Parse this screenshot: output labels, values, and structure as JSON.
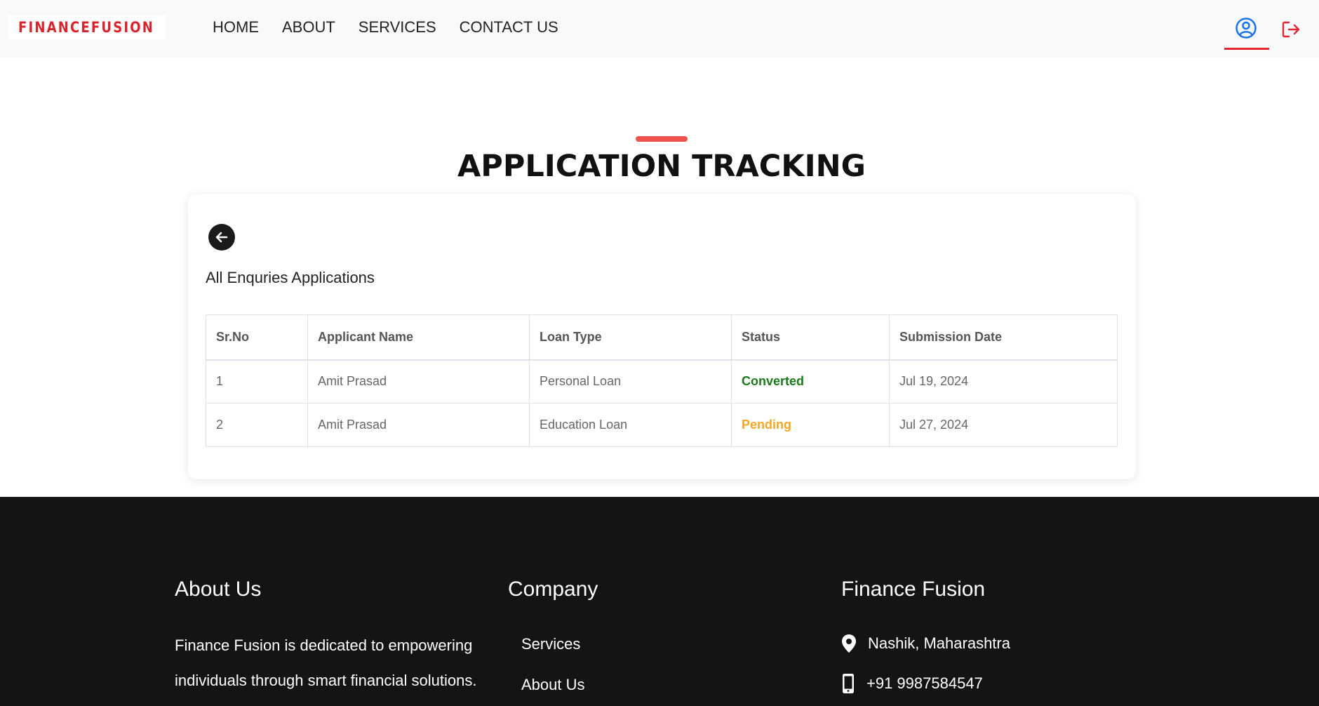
{
  "brand": {
    "name": "FINANCEFUSION",
    "accent": "#d9232d"
  },
  "nav": {
    "items": [
      {
        "label": "HOME"
      },
      {
        "label": "ABOUT"
      },
      {
        "label": "SERVICES"
      },
      {
        "label": "CONTACT US"
      }
    ],
    "user_icon": "user-circle-icon",
    "logout_icon": "logout-icon"
  },
  "page": {
    "title": "APPLICATION TRACKING"
  },
  "card": {
    "back_icon": "arrow-left-icon",
    "subtitle": "All Enquries Applications",
    "table": {
      "headers": [
        "Sr.No",
        "Applicant Name",
        "Loan Type",
        "Status",
        "Submission Date"
      ],
      "rows": [
        {
          "sr": "1",
          "name": "Amit Prasad",
          "loan_type": "Personal Loan",
          "status": "Converted",
          "date": "Jul 19, 2024"
        },
        {
          "sr": "2",
          "name": "Amit Prasad",
          "loan_type": "Education Loan",
          "status": "Pending",
          "date": "Jul 27, 2024"
        }
      ]
    },
    "status_colors": {
      "Converted": "#1b7a1b",
      "Pending": "#f5a623"
    }
  },
  "footer": {
    "about": {
      "heading": "About Us",
      "text": "Finance Fusion is dedicated to empowering individuals through smart financial solutions."
    },
    "company": {
      "heading": "Company",
      "links": [
        {
          "label": "Services"
        },
        {
          "label": "About Us"
        }
      ]
    },
    "contact": {
      "heading": "Finance Fusion",
      "location": "Nashik, Maharashtra",
      "phone": "+91 9987584547",
      "location_icon": "map-pin-icon",
      "phone_icon": "mobile-phone-icon"
    }
  }
}
